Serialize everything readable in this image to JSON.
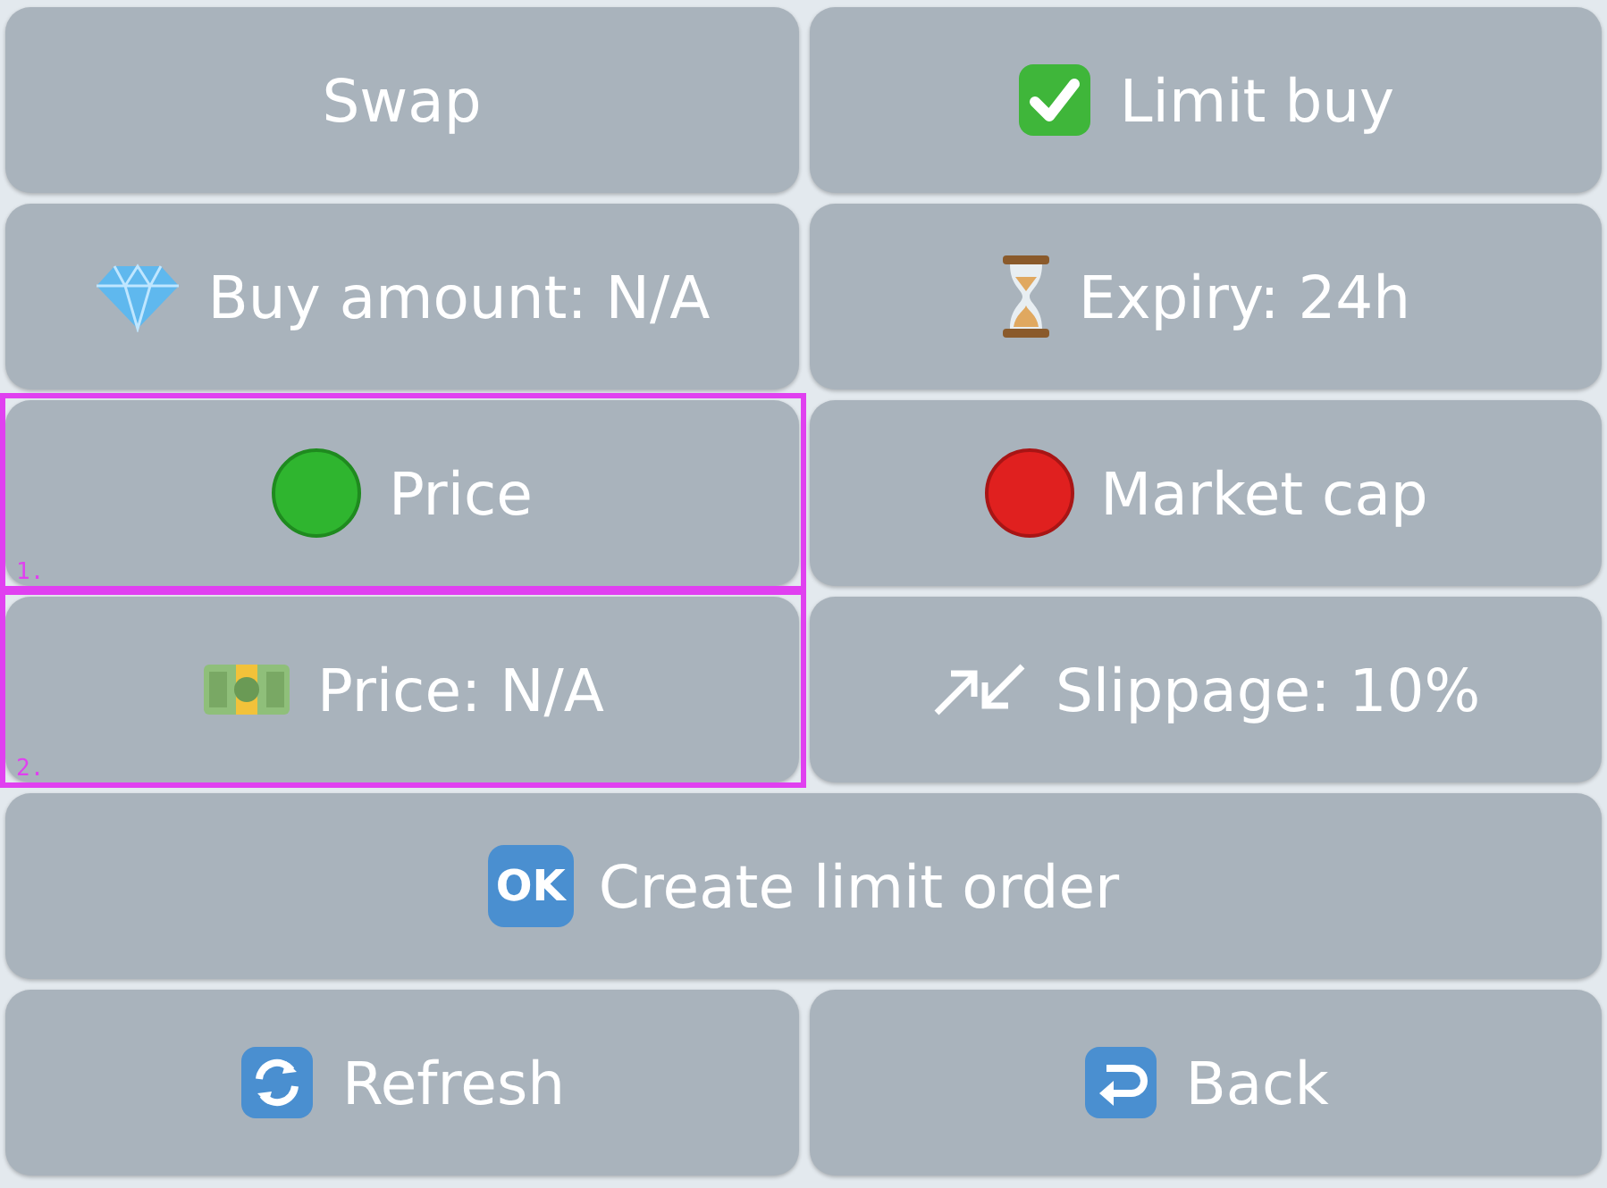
{
  "keyboard": {
    "buttons": [
      {
        "label": "Swap",
        "wide": false
      },
      {
        "label": "Limit buy",
        "wide": false
      },
      {
        "label": "Buy amount: N/A",
        "wide": false
      },
      {
        "label": "Expiry: 24h",
        "wide": false
      },
      {
        "label": "Price",
        "wide": false,
        "annotation": "1."
      },
      {
        "label": "Market cap",
        "wide": false
      },
      {
        "label": "Price: N/A",
        "wide": false,
        "annotation": "2."
      },
      {
        "label": "Slippage: 10%",
        "wide": false
      },
      {
        "label": "Create limit order",
        "wide": true,
        "badge": "OK"
      },
      {
        "label": "Refresh",
        "wide": false
      },
      {
        "label": "Back",
        "wide": false
      }
    ]
  }
}
